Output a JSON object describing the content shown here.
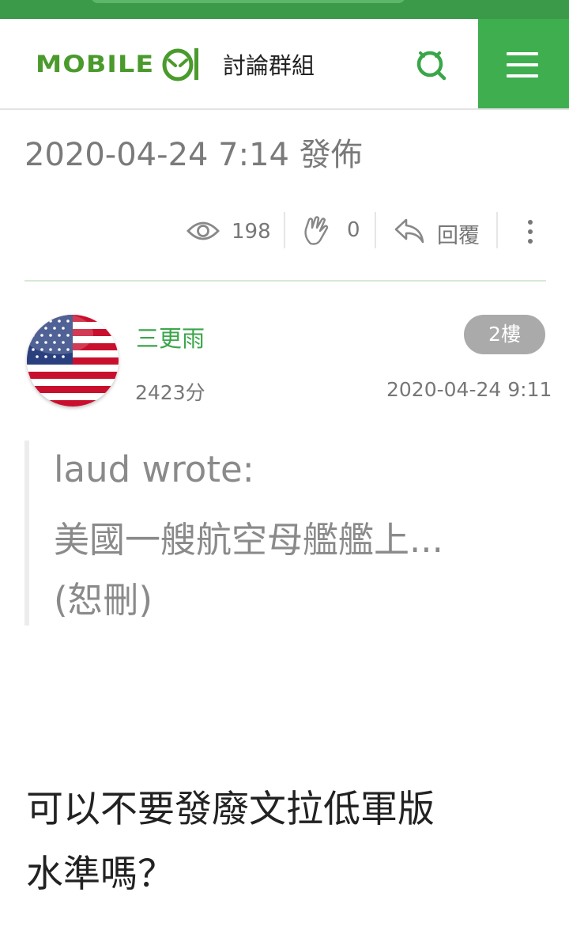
{
  "header": {
    "logo_text": "MOBILE",
    "logo_number": "01",
    "section_title": "討論群組",
    "search_icon": "search-icon",
    "menu_icon": "hamburger-menu-icon",
    "accent_color": "#3fae4f"
  },
  "post": {
    "published": "2020-04-24 7:14 發佈",
    "views": "198",
    "likes": "0",
    "reply_label": "回覆"
  },
  "reply": {
    "author_name": "三更雨",
    "author_score": "2423分",
    "floor": "2樓",
    "time": "2020-04-24 9:11",
    "quote": {
      "header": "laud wrote:",
      "excerpt": "美國一艘航空母艦艦上...",
      "note": "(恕刪)"
    },
    "body_line_1": "可以不要發廢文拉低軍版",
    "body_line_2": "水準嗎？"
  }
}
